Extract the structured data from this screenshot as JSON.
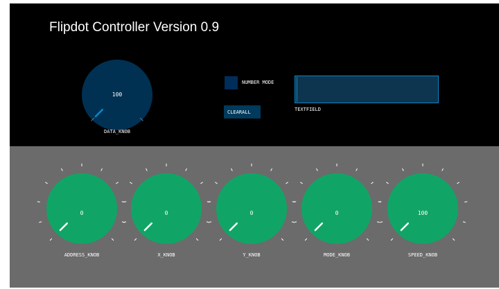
{
  "window": {
    "title": "Flipdot Controller Version 0.9"
  },
  "colors": {
    "top_bg": "#000000",
    "bottom_bg": "#6b6b6b",
    "data_knob_fill": "#003153",
    "data_knob_accent": "#0b88c6",
    "green_knob_fill": "#10a566",
    "tick_color": "#ffffff"
  },
  "data_knob": {
    "label": "DATA_KNOB",
    "value": "100",
    "level": 0.0
  },
  "number_mode": {
    "label": "NUMBER MODE",
    "checked": false
  },
  "clearall": {
    "label": "CLEARALL"
  },
  "textfield": {
    "label": "TEXTFIELD",
    "value": ""
  },
  "knobs": [
    {
      "name": "address",
      "label": "ADDRESS_KNOB",
      "value": "0",
      "level": 0.0
    },
    {
      "name": "x",
      "label": "X_KNOB",
      "value": "0",
      "level": 0.0
    },
    {
      "name": "y",
      "label": "Y_KNOB",
      "value": "0",
      "level": 0.0
    },
    {
      "name": "mode",
      "label": "MODE_KNOB",
      "value": "0",
      "level": 0.0
    },
    {
      "name": "speed",
      "label": "SPEED_KNOB",
      "value": "100",
      "level": 0.0
    }
  ]
}
